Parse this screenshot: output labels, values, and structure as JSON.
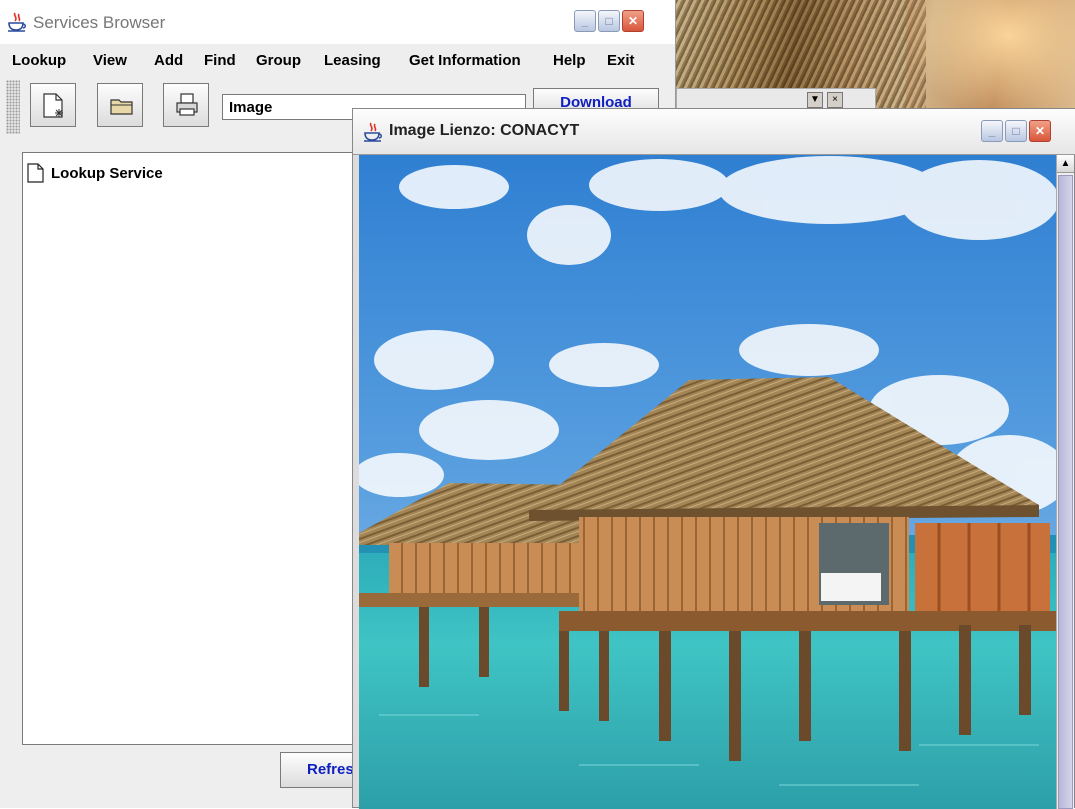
{
  "main_window": {
    "title": "Services Browser",
    "menu": [
      "Lookup",
      "View",
      "Add",
      "Find",
      "Group",
      "Leasing",
      "Get Information",
      "Help",
      "Exit"
    ],
    "combo_value": "Image",
    "download_label": "Download",
    "tree_root": "Lookup Service",
    "refresh_label": "Refresh"
  },
  "image_window": {
    "title": "Image Lienzo: CONACYT",
    "image_icon": "overwater-bungalow-photo"
  },
  "icons": {
    "app": "java-coffee-cup-icon",
    "new": "new-document-icon",
    "open": "open-folder-icon",
    "print": "printer-icon",
    "tree_node": "document-icon"
  },
  "colors": {
    "button_text": "#1020c0",
    "close_button": "#d9553a"
  }
}
